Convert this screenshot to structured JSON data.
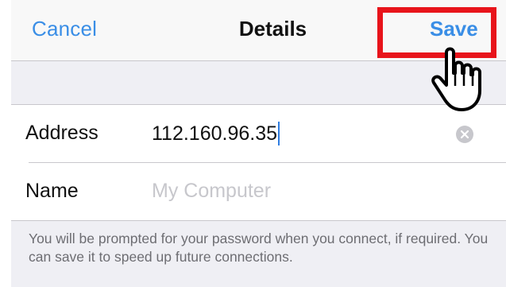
{
  "navbar": {
    "cancel_label": "Cancel",
    "title": "Details",
    "save_label": "Save"
  },
  "form": {
    "address": {
      "label": "Address",
      "value": "112.160.96.35"
    },
    "name": {
      "label": "Name",
      "placeholder": "My Computer",
      "value": ""
    }
  },
  "footer": {
    "text": "You will be prompted for your password when you connect, if required. You can save it to speed up future connections."
  },
  "annotation": {
    "highlight_color": "#e8141b",
    "pointer_icon": "hand-pointer-icon"
  },
  "colors": {
    "accent": "#3a8ee6",
    "group_background": "#efeff4"
  }
}
